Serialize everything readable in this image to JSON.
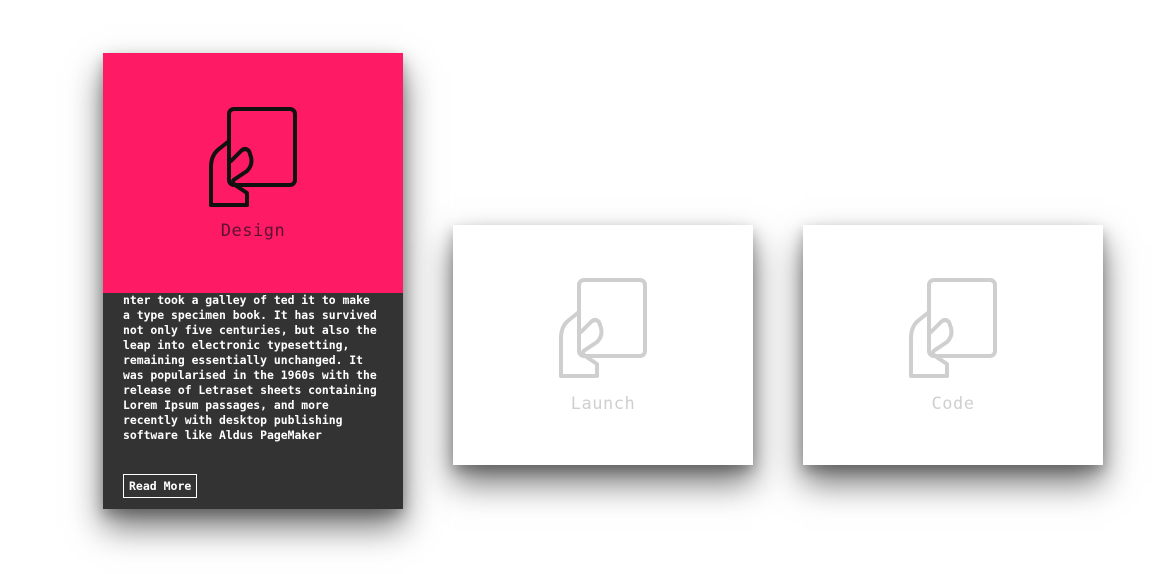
{
  "colors": {
    "accent": "#ff1a66",
    "dark_panel": "#333333",
    "inactive_gray": "#cfcfcf",
    "background": "#ffffff"
  },
  "cards": [
    {
      "title": "Design",
      "icon": "hand-holding-tablet-icon",
      "state": "expanded",
      "description": "nter took a galley of ted it to make a type specimen book. It has survived not only five centuries, but also the leap into electronic typesetting, remaining essentially unchanged. It was popularised in the 1960s with the release of Letraset sheets containing Lorem Ipsum passages, and more recently with desktop publishing software like Aldus PageMaker",
      "button_label": "Read More"
    },
    {
      "title": "Launch",
      "icon": "hand-holding-tablet-icon",
      "state": "collapsed"
    },
    {
      "title": "Code",
      "icon": "hand-holding-tablet-icon",
      "state": "collapsed"
    }
  ]
}
